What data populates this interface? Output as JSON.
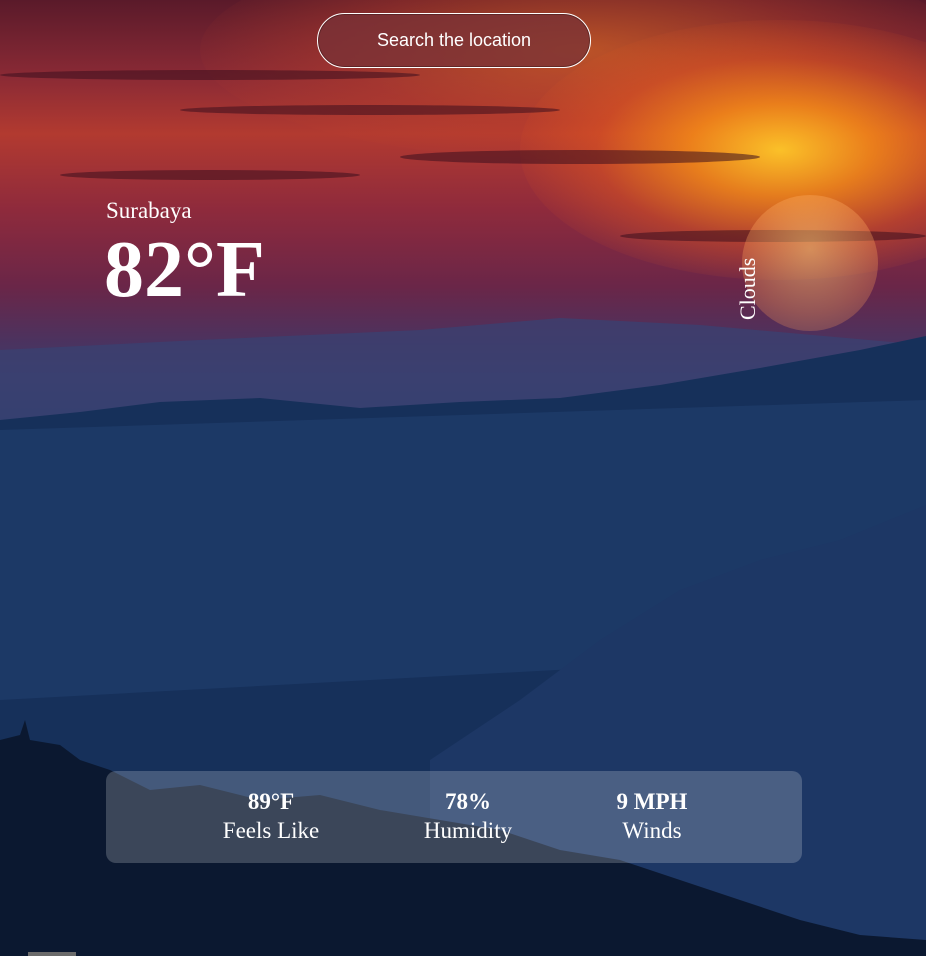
{
  "search": {
    "label": "Search the location"
  },
  "current": {
    "city": "Surabaya",
    "temperature": "82°F",
    "condition": "Clouds"
  },
  "stats": [
    {
      "value": "89°F",
      "label": "Feels Like"
    },
    {
      "value": "78%",
      "label": "Humidity"
    },
    {
      "value": "9 MPH",
      "label": "Winds"
    }
  ],
  "colors": {
    "text": "#ffffff",
    "panel": "rgba(255,255,255,0.2)",
    "sky_top": "#5a1a2a",
    "sun": "#ffc828",
    "mountains": "#0f2546"
  }
}
